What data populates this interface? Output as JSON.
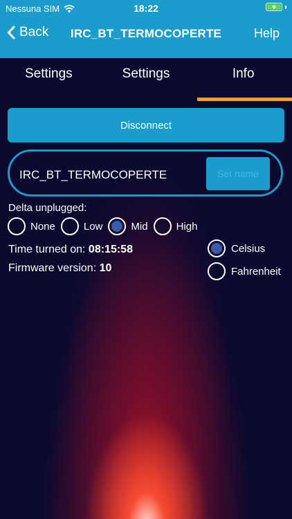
{
  "status_bar": {
    "carrier": "Nessuna SIM",
    "time": "18:22",
    "battery_color": "#5fdc4b"
  },
  "nav": {
    "back_label": "Back",
    "title": "IRC_BT_TERMOCOPERTE",
    "help_label": "Help"
  },
  "tabs": [
    {
      "label": "Settings",
      "active": false
    },
    {
      "label": "Settings",
      "active": false
    },
    {
      "label": "Info",
      "active": true
    }
  ],
  "disconnect_label": "Disconnect",
  "device_name": {
    "value": "IRC_BT_TERMOCOPERTE",
    "set_name_label": "Set name"
  },
  "delta": {
    "label": "Delta unplugged:",
    "options": [
      {
        "label": "None",
        "checked": false
      },
      {
        "label": "Low",
        "checked": false
      },
      {
        "label": "Mid",
        "checked": true
      },
      {
        "label": "High",
        "checked": false
      }
    ]
  },
  "info": {
    "time_label": "Time turned on:",
    "time_value": "08:15:58",
    "firmware_label": "Firmware version:",
    "firmware_value": "10"
  },
  "units": {
    "options": [
      {
        "label": "Celsius",
        "checked": true
      },
      {
        "label": "Fahrenheit",
        "checked": false
      }
    ]
  },
  "colors": {
    "accent": "#1a9ccc",
    "tab_indicator": "#f2a122",
    "background": "#0b0a2e",
    "radio_checked": "#3a5ba8"
  },
  "icons": [
    "wifi-icon",
    "battery-icon",
    "chevron-left-icon"
  ]
}
